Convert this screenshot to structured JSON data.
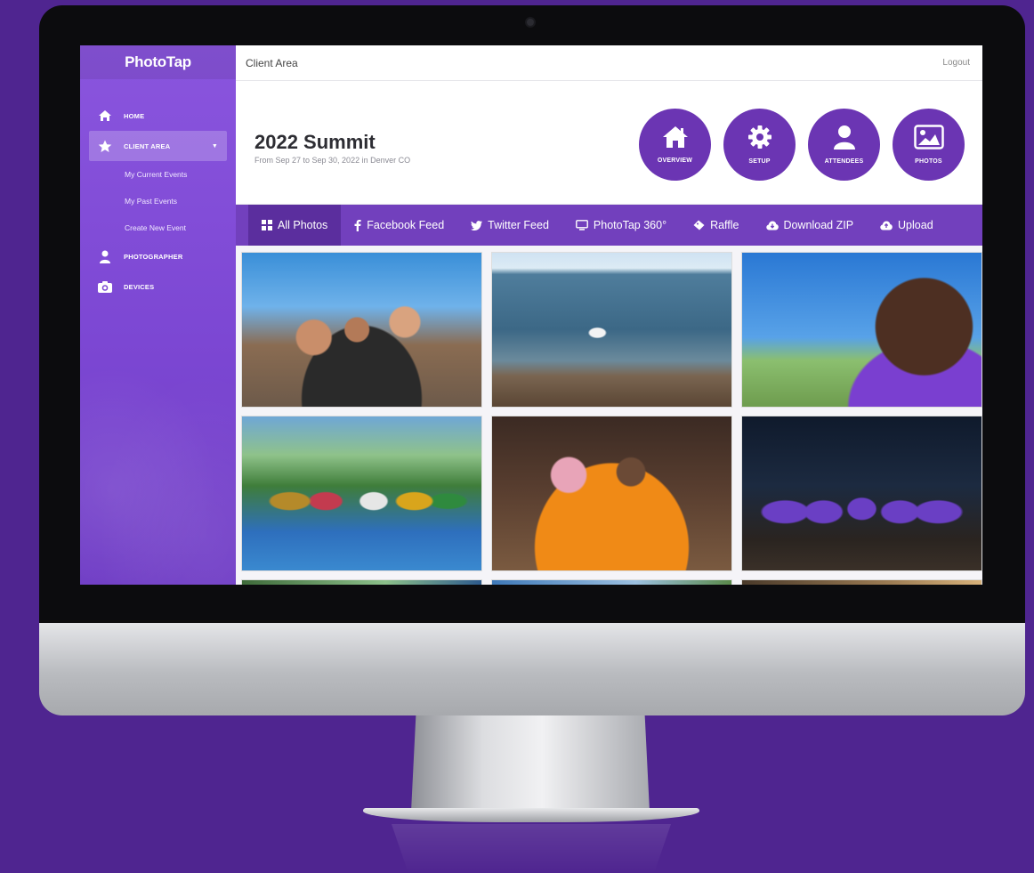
{
  "app": {
    "logo": "PhotoTap",
    "breadcrumb": "Client Area",
    "logout": "Logout"
  },
  "sidebar": {
    "items": [
      {
        "label": "HOME",
        "icon": "home-icon"
      },
      {
        "label": "CLIENT AREA",
        "icon": "star-icon",
        "active": true
      },
      {
        "label": "PHOTOGRAPHER",
        "icon": "user-icon"
      },
      {
        "label": "DEVICES",
        "icon": "camera-icon"
      }
    ],
    "sub_items": [
      "My Current Events",
      "My Past Events",
      "Create New Event"
    ]
  },
  "event": {
    "title": "2022 Summit",
    "subtitle": "From Sep 27 to Sep 30, 2022 in Denver CO"
  },
  "quick_actions": [
    {
      "label": "OVERVIEW",
      "icon": "home-icon"
    },
    {
      "label": "SETUP",
      "icon": "gear-icon"
    },
    {
      "label": "ATTENDEES",
      "icon": "user-icon"
    },
    {
      "label": "PHOTOS",
      "icon": "image-icon"
    }
  ],
  "tabs": [
    {
      "label": "All Photos",
      "icon": "grid-icon",
      "active": true
    },
    {
      "label": "Facebook Feed",
      "icon": "facebook-icon"
    },
    {
      "label": "Twitter Feed",
      "icon": "twitter-icon"
    },
    {
      "label": "PhotoTap 360°",
      "icon": "monitor-icon"
    },
    {
      "label": "Raffle",
      "icon": "ticket-icon"
    },
    {
      "label": "Download ZIP",
      "icon": "cloud-download-icon"
    },
    {
      "label": "Upload",
      "icon": "cloud-upload-icon"
    }
  ],
  "colors": {
    "background": "#4f2590",
    "sidebar": "#7c47d3",
    "accent": "#6b35b3",
    "tabbar": "#7240bd",
    "tab_active": "#5b2e9e"
  }
}
